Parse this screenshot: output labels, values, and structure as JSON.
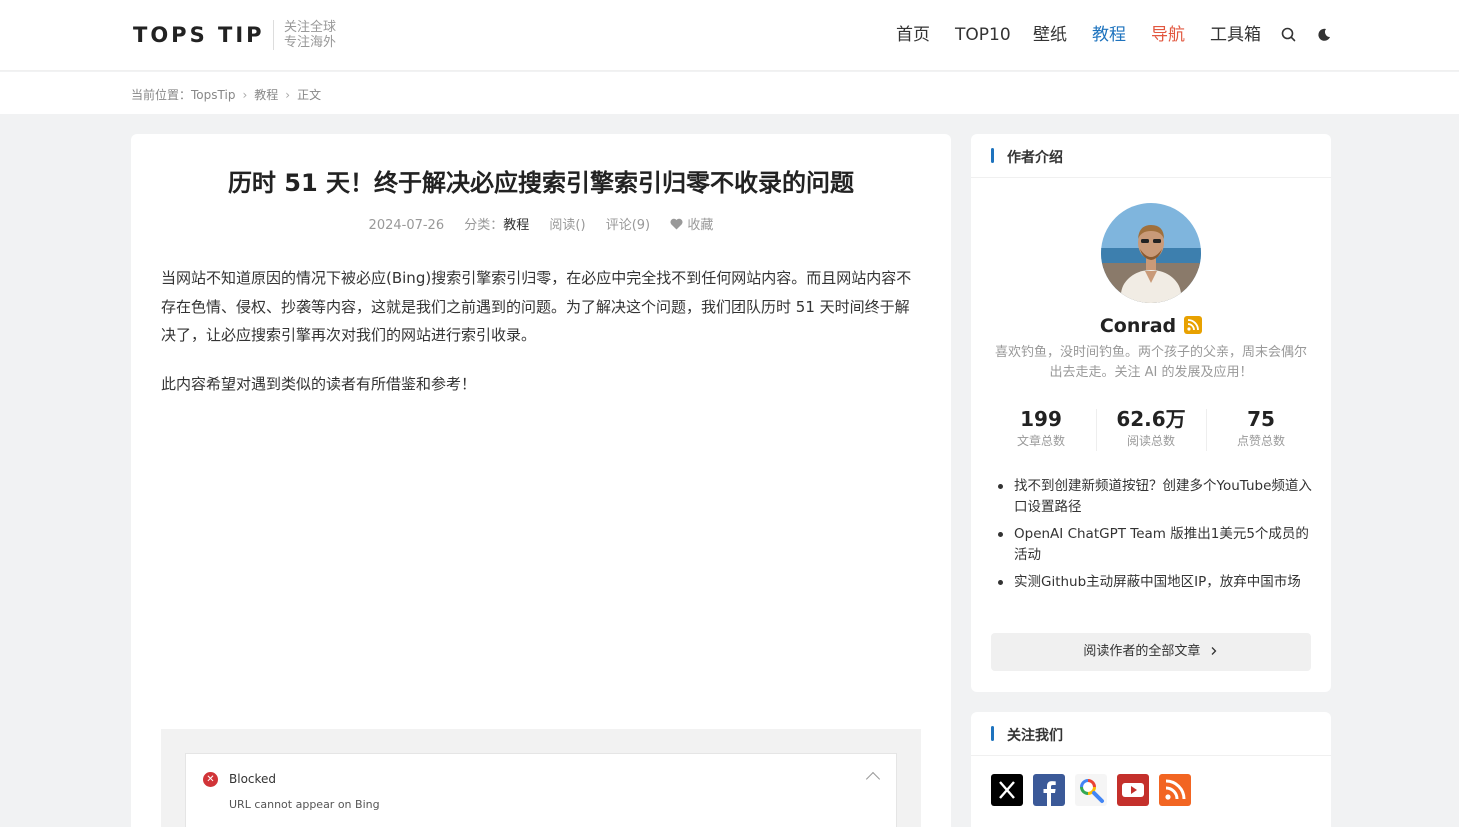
{
  "site": {
    "logo": "TOPS TIP",
    "slogan_line1": "关注全球",
    "slogan_line2": "专注海外"
  },
  "nav": {
    "items": [
      "首页",
      "TOP10",
      "壁纸",
      "教程",
      "导航",
      "工具箱"
    ],
    "active": "教程",
    "highlight": "导航",
    "accent_color": "#1e73be",
    "highlight_color": "#e2573f"
  },
  "breadcrumb": {
    "prefix": "当前位置：",
    "items": [
      "TopsTip",
      "教程",
      "正文"
    ],
    "separator": "›"
  },
  "article": {
    "title": "历时 51 天！终于解决必应搜索引擎索引归零不收录的问题",
    "date": "2024-07-26",
    "category_label": "分类：",
    "category": "教程",
    "reads": "阅读()",
    "comments": "评论(9)",
    "favorite": "收藏",
    "paragraph1": "当网站不知道原因的情况下被必应(Bing)搜索引擎索引归零，在必应中完全找不到任何网站内容。而且网站内容不存在色情、侵权、抄袭等内容，这就是我们之前遇到的问题。为了解决这个问题，我们团队历时 51 天时间终于解决了，让必应搜索引擎再次对我们的网站进行索引收录。",
    "paragraph2": "此内容希望对遇到类似的读者有所借鉴和参考！",
    "screenshot": {
      "status_title": "Blocked",
      "status_sub": "URL cannot appear on Bing"
    }
  },
  "author_box": {
    "heading": "作者介绍",
    "name": "Conrad",
    "bio": "喜欢钓鱼，没时间钓鱼。两个孩子的父亲，周末会偶尔出去走走。关注 AI 的发展及应用！",
    "stats": [
      {
        "value": "199",
        "label": "文章总数"
      },
      {
        "value": "62.6万",
        "label": "阅读总数"
      },
      {
        "value": "75",
        "label": "点赞总数"
      }
    ],
    "posts": [
      "找不到创建新频道按钮？创建多个YouTube频道入口设置路径",
      "OpenAI ChatGPT Team 版推出1美元5个成员的活动",
      "实测Github主动屏蔽中国地区IP，放弃中国市场"
    ],
    "read_all": "阅读作者的全部文章"
  },
  "follow_box": {
    "heading": "关注我们",
    "icons": [
      "x-icon",
      "facebook-icon",
      "google-search-icon",
      "youtube-icon",
      "rss-icon"
    ]
  }
}
